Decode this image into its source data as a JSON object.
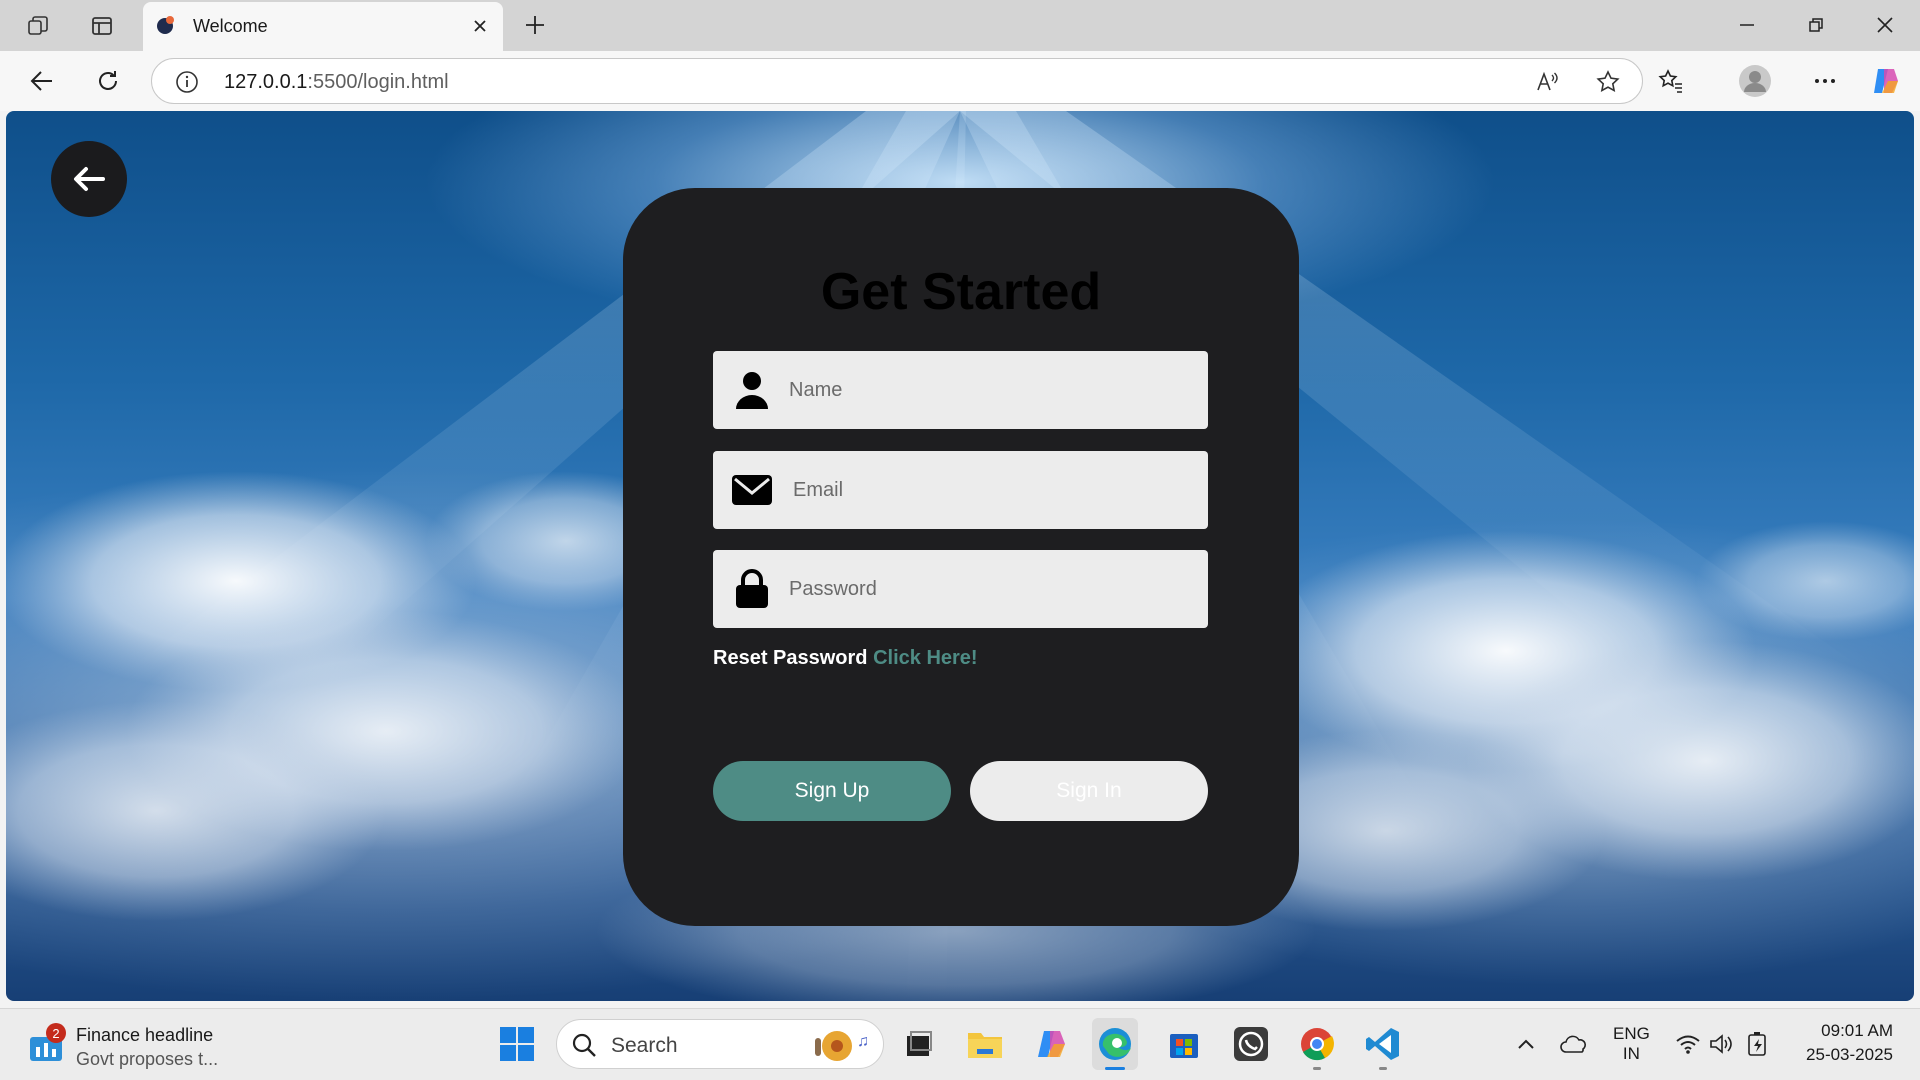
{
  "browser": {
    "tab_title": "Welcome",
    "address_host": "127.0.0.1",
    "address_path": ":5500/login.html"
  },
  "page": {
    "title": "Get Started",
    "fields": {
      "name_placeholder": "Name",
      "email_placeholder": "Email",
      "password_placeholder": "Password"
    },
    "reset_label": "Reset Password",
    "reset_link": "Click Here!",
    "signup_label": "Sign Up",
    "signin_label": "Sign In",
    "accent_color": "#4e8c85",
    "card_color": "#1e1e20"
  },
  "taskbar": {
    "widget_badge": "2",
    "widget_title": "Finance headline",
    "widget_subtitle": "Govt proposes t...",
    "search_label": "Search",
    "language_line1": "ENG",
    "language_line2": "IN",
    "time": "09:01 AM",
    "date": "25-03-2025"
  }
}
